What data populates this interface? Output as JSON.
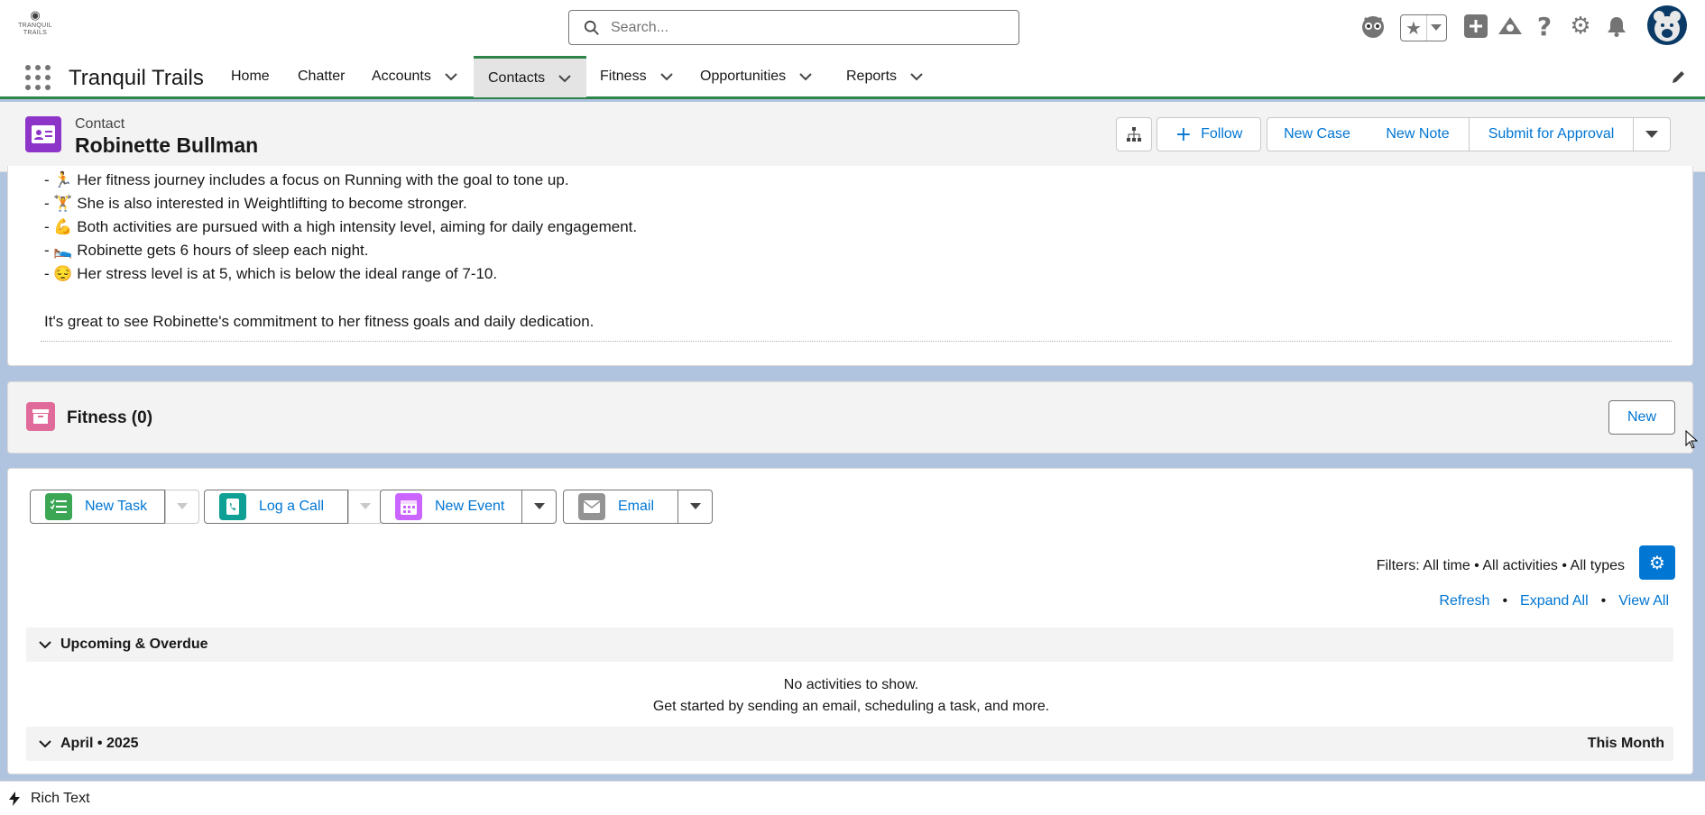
{
  "logo": {
    "line1": "TRANQUIL",
    "line2": "TRAILS"
  },
  "search": {
    "placeholder": "Search..."
  },
  "nav": {
    "app_name": "Tranquil Trails",
    "tabs": [
      {
        "label": "Home"
      },
      {
        "label": "Chatter"
      },
      {
        "label": "Accounts"
      },
      {
        "label": "Contacts"
      },
      {
        "label": "Fitness"
      },
      {
        "label": "Opportunities"
      },
      {
        "label": "Reports"
      }
    ]
  },
  "record": {
    "object_label": "Contact",
    "name": "Robinette Bullman",
    "actions": {
      "follow": "Follow",
      "new_case": "New Case",
      "new_note": "New Note",
      "submit": "Submit for Approval"
    }
  },
  "summary": {
    "lines": [
      "- 🏃 Her fitness journey includes a focus on Running with the goal to tone up.",
      "- 🏋 She is also interested in Weightlifting to become stronger.",
      "- 💪 Both activities are pursued with a high intensity level, aiming for daily engagement.",
      "- 🛌 Robinette gets 6 hours of sleep each night.",
      "- 😔 Her stress level is at 5, which is below the ideal range of 7-10."
    ],
    "closing": "It's great to see Robinette's commitment to her fitness goals and daily dedication."
  },
  "fitness": {
    "title": "Fitness (0)",
    "new_label": "New"
  },
  "activity": {
    "new_task": "New Task",
    "log_call": "Log a Call",
    "new_event": "New Event",
    "email": "Email",
    "filters": "Filters: All time • All activities • All types",
    "refresh": "Refresh",
    "expand_all": "Expand All",
    "view_all": "View All",
    "dot": "•",
    "upcoming": "Upcoming & Overdue",
    "empty1": "No activities to show.",
    "empty2": "Get started by sending an email, scheduling a task, and more.",
    "month": "April • 2025",
    "this_month": "This Month"
  },
  "utility_bar": {
    "label": "Rich Text"
  },
  "colors": {
    "accent": "#0176d3",
    "nav_active": "#2e844a",
    "contact_icon": "#8e35c9",
    "fitness_icon": "#e06b9a"
  }
}
